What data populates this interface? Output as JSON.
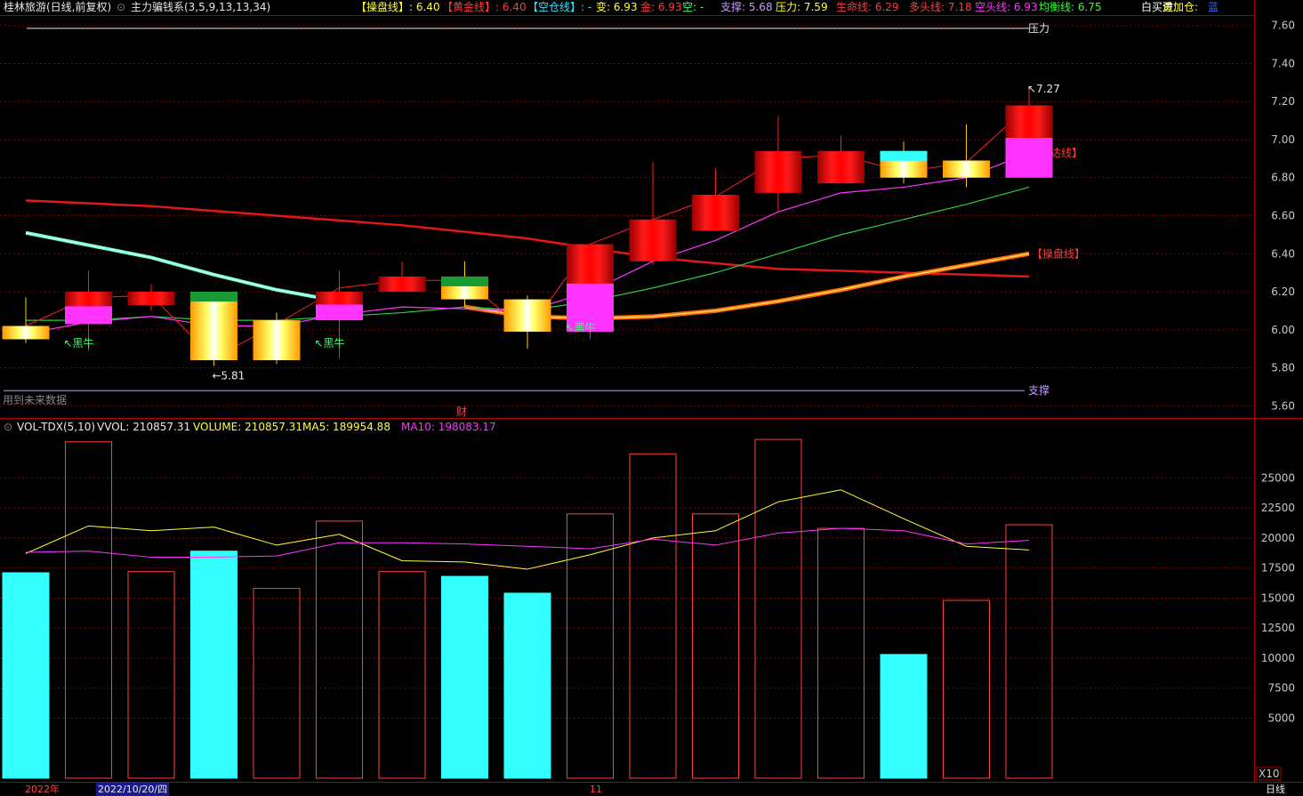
{
  "header": {
    "stock_name": "桂林旅游(日线,前复权)",
    "indicator_name": "主力骗钱系(3,5,9,13,13,34)",
    "items": [
      {
        "label": "【操盘线】:",
        "value": "6.40",
        "color": "#ffff33"
      },
      {
        "label": "【黄金线】:",
        "value": "6.40",
        "color": "#ff3b3b"
      },
      {
        "label": "【空仓线】:",
        "value": "-",
        "color": "#33e0ff"
      },
      {
        "label": "变:",
        "value": "6.93",
        "color": "#ffff33"
      },
      {
        "label": "金:",
        "value": "6.93",
        "color": "#ff3b3b"
      },
      {
        "label": "空:",
        "value": "-",
        "color": "#33ff66"
      },
      {
        "label": "支撑:",
        "value": "5.68",
        "color": "#c59bff"
      },
      {
        "label": "压力:",
        "value": "7.59",
        "color": "#ffff33"
      },
      {
        "label": "生命线:",
        "value": "6.29",
        "color": "#ff3b3b"
      },
      {
        "label": "多头线:",
        "value": "7.18",
        "color": "#ff4040"
      },
      {
        "label": "空头线:",
        "value": "6.93",
        "color": "#ff33ff"
      },
      {
        "label": "均衡线:",
        "value": "6.75",
        "color": "#33ff33"
      },
      {
        "label": "白买进:",
        "value": "",
        "color": "#ffffff"
      },
      {
        "label": "黄加仓:",
        "value": "",
        "color": "#ffff33"
      },
      {
        "label": "蓝",
        "value": "",
        "color": "#3366ff"
      }
    ]
  },
  "price_panel": {
    "y_ticks": [
      "7.60",
      "7.40",
      "7.20",
      "7.00",
      "6.80",
      "6.60",
      "6.40",
      "6.20",
      "6.00",
      "5.80",
      "5.60"
    ],
    "annotations": {
      "high_label": "7.27",
      "low_label": "5.81",
      "pressure_label": "压力",
      "support_label": "支撑",
      "caopan_label": "【操盘线】",
      "duotou_label": "达线】",
      "future_data": "用到未来数据",
      "signal_label": "黑牛",
      "finance_mark": "财"
    }
  },
  "volume_panel": {
    "title": "VOL-TDX(5,10)",
    "vvol": "VVOL: 210857.31",
    "volume": "VOLUME: 210857.31",
    "ma5": "MA5: 189954.88",
    "ma10": "MA10: 198083.17",
    "y_ticks": [
      "25000",
      "22500",
      "20000",
      "17500",
      "15000",
      "12500",
      "10000",
      "7500",
      "5000"
    ],
    "multiplier": "X10"
  },
  "bottom": {
    "year": "2022年",
    "date": "2022/10/20/四",
    "month_mark": "11",
    "period": "日线"
  },
  "colors": {
    "bg": "#000000",
    "grid": "#8b0000",
    "up": "#ff0000",
    "down_vol": "#33ffff",
    "magenta": "#ff33ff",
    "yellow": "#ffff33",
    "green": "#33cc33",
    "axis_text": "#c8c8c8"
  },
  "chart_data": {
    "type": "candlestick",
    "price_ylim": [
      5.55,
      7.65
    ],
    "volume_ylim": [
      0,
      28500
    ],
    "candles": [
      {
        "open": 6.02,
        "close": 5.95,
        "high": 6.17,
        "low": 5.93,
        "style": "gold"
      },
      {
        "open": 6.2,
        "close": 6.03,
        "high": 6.31,
        "low": 5.89,
        "style": "red",
        "cap": "magenta"
      },
      {
        "open": 6.2,
        "close": 6.13,
        "high": 6.24,
        "low": 6.1,
        "style": "red"
      },
      {
        "open": 6.2,
        "close": 5.84,
        "high": 6.2,
        "low": 5.81,
        "style": "gold",
        "cap": "green"
      },
      {
        "open": 6.05,
        "close": 5.84,
        "high": 6.09,
        "low": 5.82,
        "style": "gold"
      },
      {
        "open": 6.2,
        "close": 6.05,
        "high": 6.31,
        "low": 5.85,
        "style": "red",
        "cap": "magenta"
      },
      {
        "open": 6.28,
        "close": 6.2,
        "high": 6.36,
        "low": 6.2,
        "style": "red"
      },
      {
        "open": 6.28,
        "close": 6.16,
        "high": 6.36,
        "low": 6.12,
        "style": "gold",
        "cap": "green"
      },
      {
        "open": 6.16,
        "close": 5.99,
        "high": 6.18,
        "low": 5.9,
        "style": "gold"
      },
      {
        "open": 6.45,
        "close": 5.99,
        "high": 6.45,
        "low": 5.95,
        "style": "red",
        "cap": "magenta"
      },
      {
        "open": 6.58,
        "close": 6.36,
        "high": 6.88,
        "low": 6.34,
        "style": "red"
      },
      {
        "open": 6.71,
        "close": 6.52,
        "high": 6.85,
        "low": 6.52,
        "style": "red"
      },
      {
        "open": 6.94,
        "close": 6.72,
        "high": 7.12,
        "low": 6.62,
        "style": "red"
      },
      {
        "open": 6.94,
        "close": 6.77,
        "high": 7.02,
        "low": 6.77,
        "style": "red"
      },
      {
        "open": 6.94,
        "close": 6.8,
        "high": 6.99,
        "low": 6.77,
        "style": "gold",
        "cap": "cyan"
      },
      {
        "open": 6.89,
        "close": 6.8,
        "high": 7.08,
        "low": 6.75,
        "style": "gold"
      },
      {
        "open": 7.18,
        "close": 6.8,
        "high": 7.27,
        "low": 6.8,
        "style": "red",
        "cap": "magenta"
      }
    ],
    "lines": {
      "life_line": [
        6.68,
        null,
        6.65,
        null,
        6.6,
        null,
        6.55,
        null,
        6.48,
        null,
        6.38,
        null,
        6.32,
        null,
        6.3,
        null,
        6.28
      ],
      "caopan_line": [
        null,
        null,
        null,
        null,
        null,
        null,
        null,
        6.12,
        6.07,
        6.06,
        6.07,
        6.1,
        6.15,
        6.21,
        6.28,
        6.34,
        6.4
      ],
      "cyan_line": [
        6.51,
        null,
        6.38,
        6.29,
        6.21,
        6.15,
        null,
        null,
        null
      ],
      "balance_line": [
        6.05,
        6.05,
        6.07,
        6.05,
        6.05,
        6.07,
        6.09,
        6.12,
        6.1,
        6.15,
        6.22,
        6.3,
        6.4,
        6.5,
        6.58,
        6.66,
        6.75
      ],
      "magenta_line": [
        5.98,
        6.04,
        6.07,
        6.02,
        6.02,
        6.08,
        6.12,
        6.11,
        6.1,
        6.2,
        6.36,
        6.47,
        6.62,
        6.72,
        6.75,
        6.8,
        6.93
      ],
      "thin_red_line": [
        6.02,
        6.17,
        6.18,
        5.85,
        6.03,
        6.22,
        6.26,
        6.26,
        5.99,
        6.45,
        6.58,
        6.7,
        6.9,
        6.92,
        6.83,
        6.88,
        7.18
      ]
    },
    "volume": {
      "values": [
        17100,
        28000,
        17200,
        18900,
        15800,
        21400,
        17200,
        16800,
        15400,
        22000,
        27000,
        22000,
        28200,
        20800,
        10300,
        14800,
        21100
      ],
      "filled": [
        true,
        false,
        false,
        true,
        false,
        false,
        false,
        true,
        true,
        false,
        false,
        false,
        false,
        false,
        true,
        false,
        false
      ],
      "ma5": [
        18700,
        21000,
        20600,
        20900,
        19400,
        20300,
        18100,
        18000,
        17400,
        18600,
        20000,
        20600,
        23000,
        24000,
        21600,
        19300,
        19000
      ],
      "ma10": [
        18800,
        18900,
        18400,
        18400,
        18500,
        19600,
        19600,
        19500,
        19300,
        19100,
        19900,
        19400,
        20400,
        20800,
        20600,
        19500,
        19800
      ]
    }
  }
}
